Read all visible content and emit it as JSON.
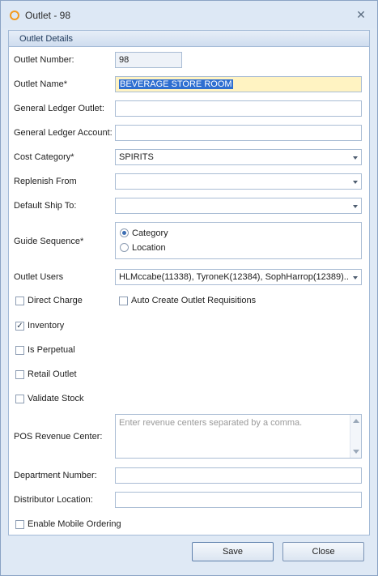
{
  "window": {
    "title": "Outlet - 98",
    "close_glyph": "✕",
    "icon": "circle-outline-icon",
    "accent": "#f39a1e"
  },
  "group": {
    "title": "Outlet Details"
  },
  "fields": {
    "outlet_number": {
      "label": "Outlet Number:",
      "value": "98"
    },
    "outlet_name": {
      "label": "Outlet Name*",
      "value": "BEVERAGE STORE ROOM"
    },
    "gl_outlet": {
      "label": "General Ledger Outlet:",
      "value": ""
    },
    "gl_account": {
      "label": "General Ledger Account:",
      "value": ""
    },
    "cost_category": {
      "label": "Cost Category*",
      "value": "SPIRITS"
    },
    "replenish_from": {
      "label": "Replenish From",
      "value": ""
    },
    "default_ship_to": {
      "label": "Default Ship To:",
      "value": ""
    },
    "guide_sequence": {
      "label": "Guide Sequence*",
      "options": [
        "Category",
        "Location"
      ],
      "selected": "Category"
    },
    "outlet_users": {
      "label": "Outlet Users",
      "value": "HLMccabe(11338), TyroneK(12384), SophHarrop(12389)..."
    },
    "pos_revenue_center": {
      "label": "POS Revenue Center:",
      "placeholder": "Enter revenue centers separated by a comma."
    },
    "department_number": {
      "label": "Department Number:",
      "value": ""
    },
    "distributor_location": {
      "label": "Distributor Location:",
      "value": ""
    }
  },
  "checkboxes": {
    "direct_charge": {
      "label": "Direct Charge",
      "checked": false
    },
    "auto_create": {
      "label": "Auto Create Outlet Requisitions",
      "checked": false
    },
    "inventory": {
      "label": "Inventory",
      "checked": true,
      "mark": "✓"
    },
    "is_perpetual": {
      "label": "Is Perpetual",
      "checked": false
    },
    "retail_outlet": {
      "label": "Retail Outlet",
      "checked": false
    },
    "validate_stock": {
      "label": "Validate Stock",
      "checked": false
    },
    "enable_mobile": {
      "label": "Enable Mobile Ordering",
      "checked": false
    }
  },
  "buttons": {
    "save": "Save",
    "close": "Close"
  }
}
